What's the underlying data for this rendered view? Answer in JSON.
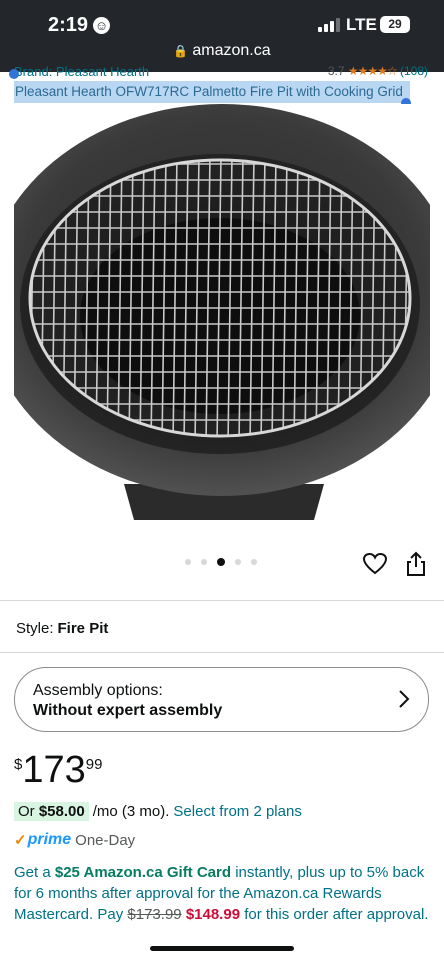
{
  "status_bar": {
    "time": "2:19",
    "time_icon": "smiley-face-icon",
    "network": "LTE",
    "battery": "29",
    "url": "amazon.ca"
  },
  "header": {
    "brand": "Brand: Pleasant Hearth",
    "rating": "3.7",
    "reviews": "(108)",
    "title": "Pleasant Hearth OFW717RC Palmetto Fire Pit with Cooking Grid"
  },
  "gallery": {
    "dot_count": 5,
    "active_dot": 3,
    "favorite_icon": "heart-icon",
    "share_icon": "share-icon"
  },
  "style": {
    "label": "Style:",
    "value": "Fire Pit"
  },
  "assembly": {
    "label": "Assembly options:",
    "value": "Without expert assembly"
  },
  "price": {
    "symbol": "$",
    "whole": "173",
    "fraction": "99"
  },
  "monthly": {
    "prefix": "Or",
    "amount": "$58.00",
    "term": "/mo (3 mo).",
    "link": "Select from 2 plans"
  },
  "prime": {
    "check": "✓",
    "brand": "prime",
    "delivery": "One-Day"
  },
  "promo": {
    "p1": "Get a",
    "gift": "$25 Amazon.ca Gift Card",
    "p2": "instantly, plus up to 5% back for 6 months after approval for the Amazon.ca Rewards Mastercard.",
    "pay": "Pay",
    "old_price": "$173.99",
    "new_price": "$148.99",
    "p3": "for this order after approval."
  },
  "colors": {
    "status_bg": "#23262b",
    "link": "#007185",
    "selection": "#b9d6f3",
    "price_red": "#cc0c39",
    "green": "#067d62"
  }
}
